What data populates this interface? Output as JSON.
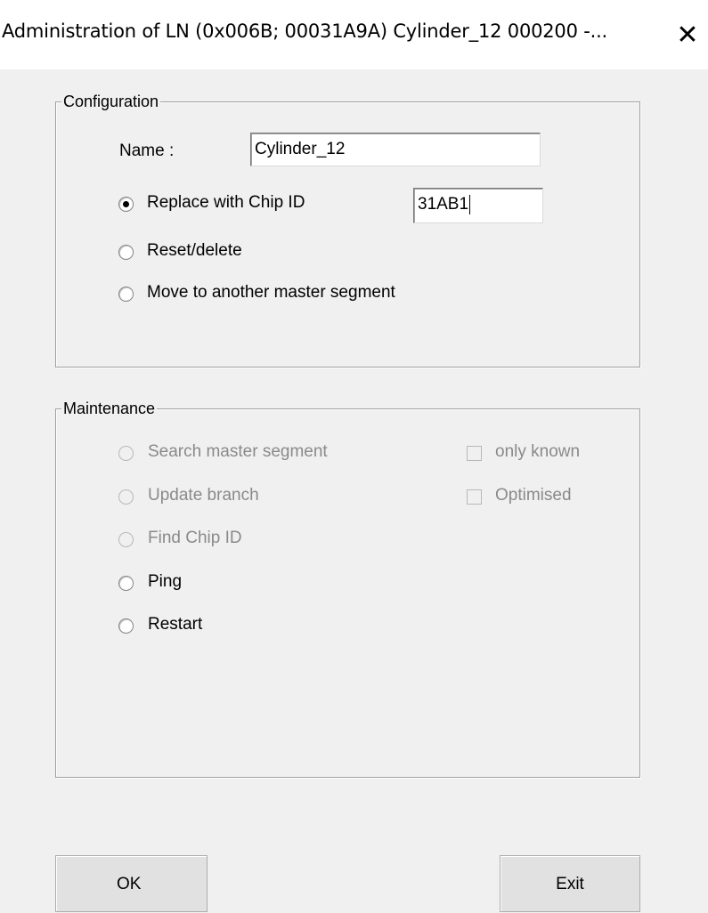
{
  "window": {
    "title": "Administration of LN (0x006B; 00031A9A)   Cylinder_12   000200 -...",
    "close_symbol": "✕"
  },
  "configuration": {
    "legend": "Configuration",
    "name_label": "Name :",
    "name_value": "Cylinder_12",
    "options": [
      {
        "label": "Replace with Chip ID",
        "checked": true
      },
      {
        "label": "Reset/delete",
        "checked": false
      },
      {
        "label": "Move to another master segment",
        "checked": false
      }
    ],
    "chip_id_value": "31AB1"
  },
  "maintenance": {
    "legend": "Maintenance",
    "options": [
      {
        "label": "Search master segment",
        "enabled": false
      },
      {
        "label": "Update branch",
        "enabled": false
      },
      {
        "label": "Find Chip ID",
        "enabled": false
      },
      {
        "label": "Ping",
        "enabled": true
      },
      {
        "label": "Restart",
        "enabled": true
      }
    ],
    "checkboxes": [
      {
        "label": "only known",
        "enabled": false,
        "checked": false
      },
      {
        "label": "Optimised",
        "enabled": false,
        "checked": false
      }
    ]
  },
  "buttons": {
    "ok_label": "OK",
    "exit_label": "Exit"
  }
}
